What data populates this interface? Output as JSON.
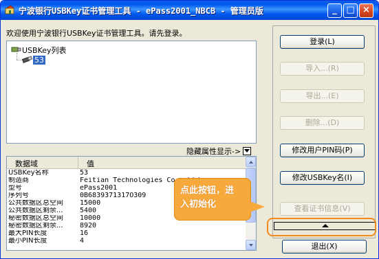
{
  "window": {
    "title": "宁波银行USBKey证书管理工具 - ePass2001_NBCB - 管理员版",
    "minimize_glyph": "_",
    "maximize_glyph": "□",
    "close_glyph": "×"
  },
  "main": {
    "welcome": "欢迎使用宁波银行USBKey证书管理工具。请先登录。",
    "tree": {
      "root_label": "USBKey列表",
      "child_label": "53"
    },
    "hide_attributes": "隐藏属性显示->"
  },
  "grid": {
    "headers": [
      "数据域",
      "值"
    ],
    "rows": [
      {
        "key": "USBKey名称",
        "value": "53"
      },
      {
        "key": "制造商",
        "value": "Feitian Technologies Co., Ltd."
      },
      {
        "key": "型号",
        "value": "ePass2001"
      },
      {
        "key": "序列号",
        "value": "0B6839371317O309"
      },
      {
        "key": "公共数据区总空间",
        "value": "15000"
      },
      {
        "key": "公共数据区剩余...",
        "value": "5400"
      },
      {
        "key": "秘密数据区总空间",
        "value": "10000"
      },
      {
        "key": "秘密数据区剩余...",
        "value": "8920"
      },
      {
        "key": "最大PIN长度",
        "value": "16"
      },
      {
        "key": "最小PIN长度",
        "value": "4"
      }
    ]
  },
  "buttons": {
    "login": "登录(L)",
    "import": "导入...(R)",
    "export": "导出...(E)",
    "delete": "删除...(D)",
    "change_pin": "修改用户PIN码(P)",
    "rename_key": "修改USBKey名(I)",
    "view_cert": "查看证书信息(V)",
    "exit": "退出(X)"
  },
  "callout": {
    "line1": "点此按钮，进",
    "line2": "入初始化"
  },
  "colors": {
    "titlebar": "#0058ee",
    "callout": "#f7a93b",
    "highlight": "#f28a1d",
    "selection": "#316ac5"
  }
}
